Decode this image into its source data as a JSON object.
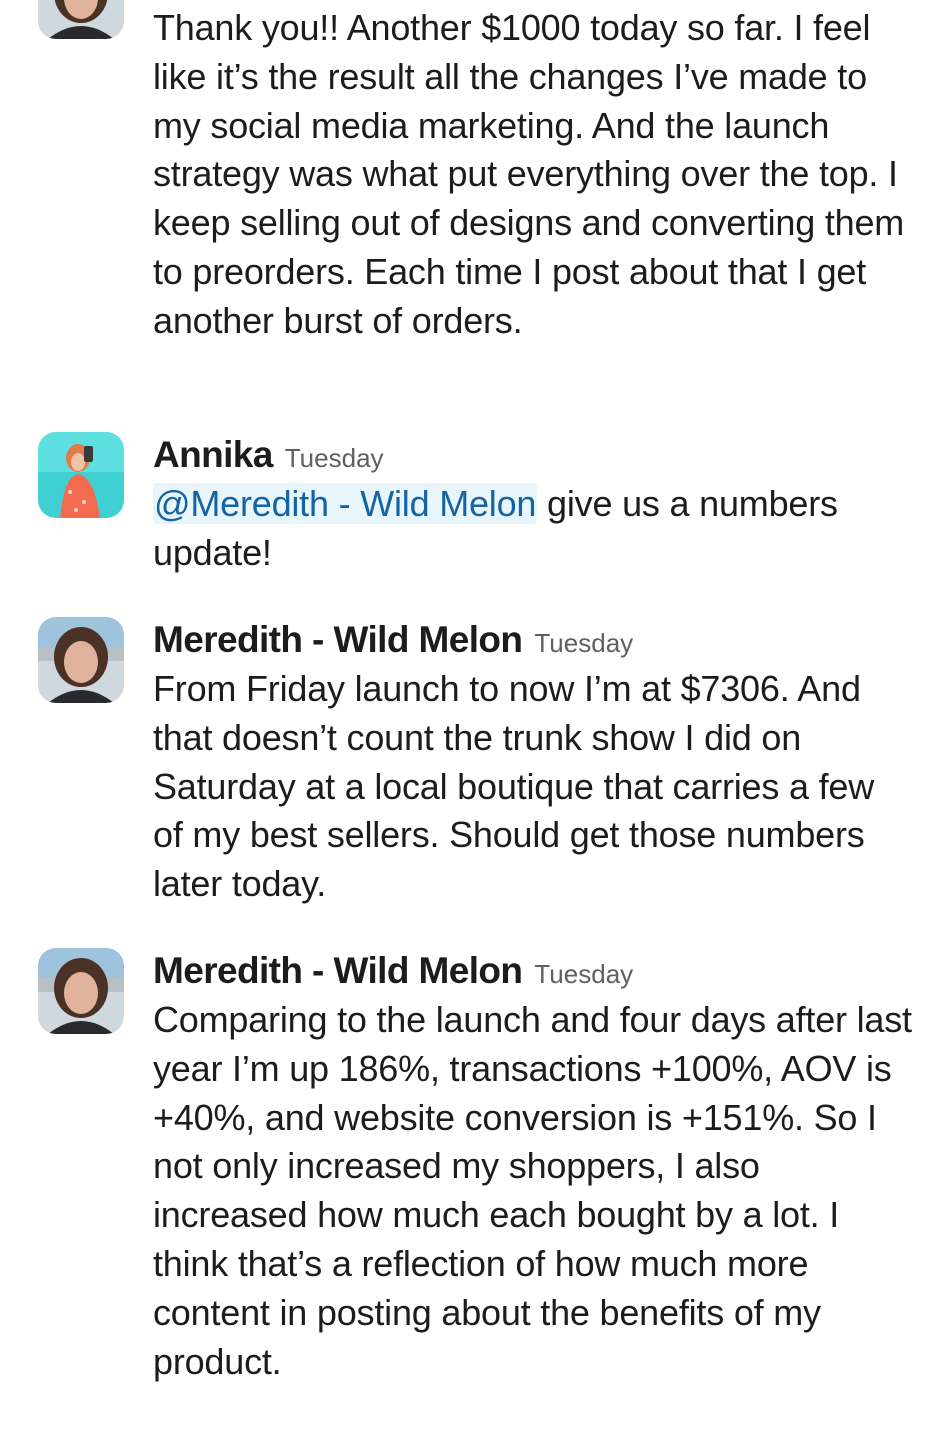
{
  "messages": [
    {
      "author": "",
      "time": "",
      "avatar": "meredith-photo",
      "text": "Thank you!! Another $1000 today so far. I feel like it’s the result all the changes I’ve made to my social media marketing. And the launch strategy was what put everything over the top. I keep selling out of designs and converting them to preorders. Each time I post about that I get another burst of orders."
    },
    {
      "author": "Annika",
      "time": "Tuesday",
      "avatar": "annika-photo",
      "mention": "@Meredith - Wild Melon",
      "text": " give us a numbers update!"
    },
    {
      "author": "Meredith - Wild Melon",
      "time": "Tuesday",
      "avatar": "meredith-photo",
      "text": "From Friday launch to now I’m at $7306. And that doesn’t count the trunk show I did on Saturday at a local boutique that carries a few of my best sellers. Should get those numbers later today."
    },
    {
      "author": "Meredith - Wild Melon",
      "time": "Tuesday",
      "avatar": "meredith-photo",
      "text": "Comparing to the launch and four days after last year I’m up 186%, transactions +100%, AOV is +40%, and website conversion is +151%. So I not only increased my shoppers, I also increased how much each bought by a lot. I think that’s a reflection of how much more content in posting about the benefits of my product."
    }
  ],
  "colors": {
    "text": "#1d1c1d",
    "timestamp": "#616061",
    "mention_text": "#1264a3",
    "mention_bg": "#e8f5fa"
  }
}
